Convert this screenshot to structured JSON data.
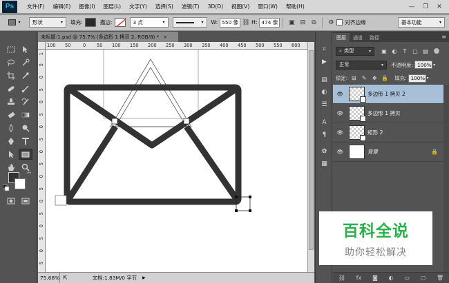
{
  "app": {
    "logo": "Ps"
  },
  "menu": [
    "文件(F)",
    "编辑(E)",
    "图像(I)",
    "图层(L)",
    "文字(Y)",
    "选择(S)",
    "滤镜(T)",
    "3D(D)",
    "视图(V)",
    "窗口(W)",
    "帮助(H)"
  ],
  "window_controls": {
    "minimize": "—",
    "restore": "❐",
    "close": "✕"
  },
  "options_bar": {
    "mode": "形状",
    "fill_label": "填充:",
    "fill_color": "#2b2b2b",
    "stroke_label": "描边:",
    "stroke_width": "3 点",
    "w_label": "W:",
    "w_value": "550 像",
    "h_label": "H:",
    "h_value": "474 像",
    "align_edges_label": "对齐边缘",
    "workspace": "基本功能"
  },
  "document": {
    "tab_title": "未标题-1.psd @ 75.7% (多边形 1 拷贝 2, RGB/8) *",
    "close_glyph": "×",
    "ruler_top": [
      "100",
      "50",
      "0",
      "50",
      "100",
      "150",
      "200",
      "250",
      "300",
      "350",
      "400",
      "450",
      "500",
      "550",
      "600",
      "650",
      "700",
      "750"
    ],
    "ruler_left": [
      "1",
      "5",
      "0",
      "5",
      "0",
      "5",
      "0",
      "5",
      "0",
      "5",
      "0",
      "5",
      "0",
      "5",
      "0",
      "5",
      "0",
      "5",
      "0",
      "5"
    ],
    "stroke_color": "#333333"
  },
  "status": {
    "zoom": "75.68%",
    "doc_info": "文档:1.83M/0 字节"
  },
  "layers_panel": {
    "tabs": [
      "图层",
      "通道",
      "路径"
    ],
    "kind_filter": "类型",
    "blend_mode": "正常",
    "opacity_label": "不透明度:",
    "opacity_value": "100%",
    "lock_label": "锁定:",
    "fill_label": "填充:",
    "fill_value": "100%",
    "layers": [
      {
        "name": "多边形 1 拷贝 2",
        "selected": true
      },
      {
        "name": "多边形 1 拷贝",
        "selected": false
      },
      {
        "name": "矩形 2",
        "selected": false
      },
      {
        "name": "背景",
        "selected": false
      }
    ]
  },
  "watermark": {
    "title": "百科全说",
    "subtitle": "助你轻松解决"
  }
}
